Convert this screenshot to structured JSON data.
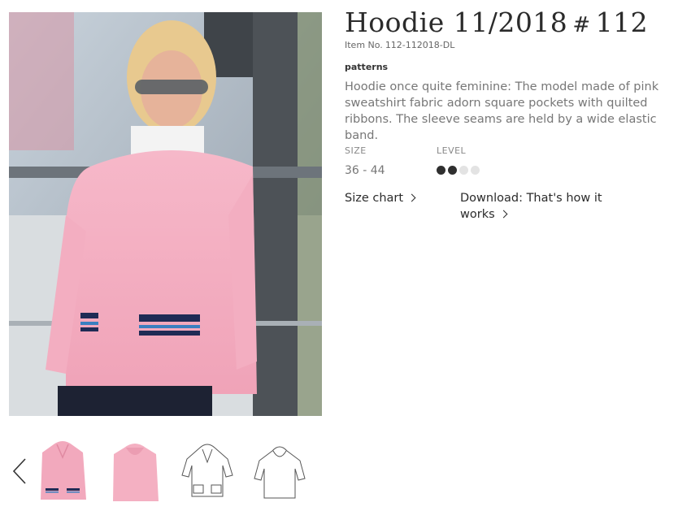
{
  "product": {
    "title": "Hoodie 11/2018",
    "hash": "#",
    "number": "112",
    "item_no_label": "Item No.",
    "item_no": "112-112018-DL",
    "category": "patterns",
    "description": "Hoodie once quite feminine: The model made of pink sweatshirt fabric adorn square pockets with quilted ribbons. The sleeve seams are held by a wide elastic band."
  },
  "meta": {
    "size_label": "SIZE",
    "size_value": "36 - 44",
    "level_label": "LEVEL",
    "level_filled": 2,
    "level_total": 4
  },
  "links": {
    "size_chart": "Size chart",
    "download": "Download: That's how it works"
  },
  "gallery": {
    "thumbnails": [
      "front-photo",
      "back-photo",
      "front-technical-drawing",
      "back-technical-drawing"
    ]
  },
  "colors": {
    "hoodie_pink": "#f2a9bd",
    "stripe_navy": "#1f2b55"
  }
}
